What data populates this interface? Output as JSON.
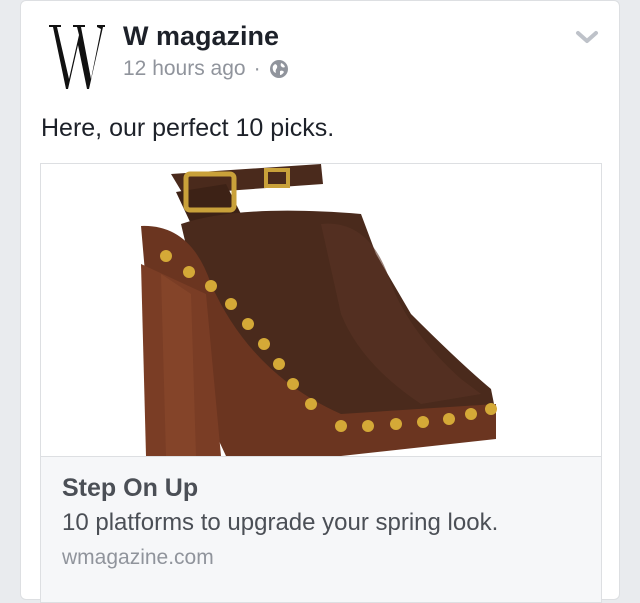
{
  "post": {
    "page_name": "W magazine",
    "time": "12 hours ago",
    "separator": "·",
    "privacy_icon": "globe-icon",
    "text": "Here, our perfect 10 picks.",
    "options_icon": "chevron-down-icon"
  },
  "logo": {
    "icon": "w-magazine-logo"
  },
  "link_preview": {
    "image": "brown-platform-shoe-image",
    "title": "Step On Up",
    "description": "10 platforms to upgrade your spring look.",
    "domain": "wmagazine.com"
  },
  "colors": {
    "background": "#e9ebee",
    "name": "#1d2129",
    "meta": "#90949c",
    "preview_bg": "#f6f7f9",
    "shoe_leather": "#4a2a1c",
    "shoe_wood": "#6b3520",
    "studs": "#d4a937"
  }
}
